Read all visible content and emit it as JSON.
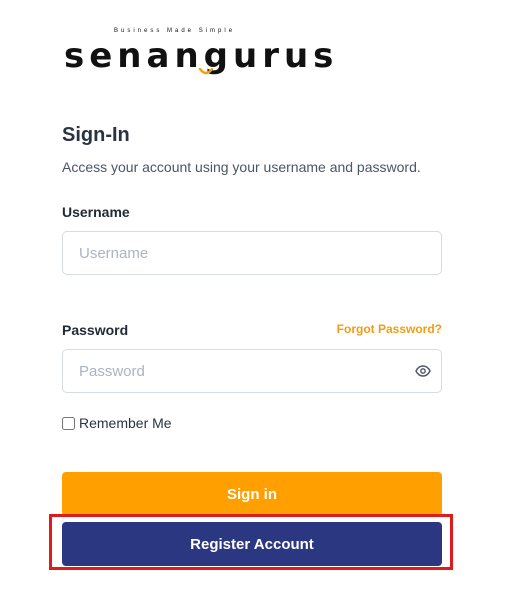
{
  "brand": {
    "tagline": "Business Made Simple",
    "name": "senangurus",
    "accent_color": "#f5a20a"
  },
  "signin": {
    "title": "Sign-In",
    "subtitle": "Access your account using your username and password."
  },
  "username": {
    "label": "Username",
    "placeholder": "Username",
    "value": ""
  },
  "password": {
    "label": "Password",
    "placeholder": "Password",
    "value": "",
    "forgot_label": "Forgot Password?",
    "toggle_icon": "eye-icon"
  },
  "remember": {
    "label": "Remember Me",
    "checked": false
  },
  "buttons": {
    "signin_label": "Sign in",
    "register_label": "Register Account",
    "signin_color": "#ff9f00",
    "register_color": "#2c3781"
  },
  "highlight": {
    "color": "#e01b1b",
    "target": "register-button"
  }
}
